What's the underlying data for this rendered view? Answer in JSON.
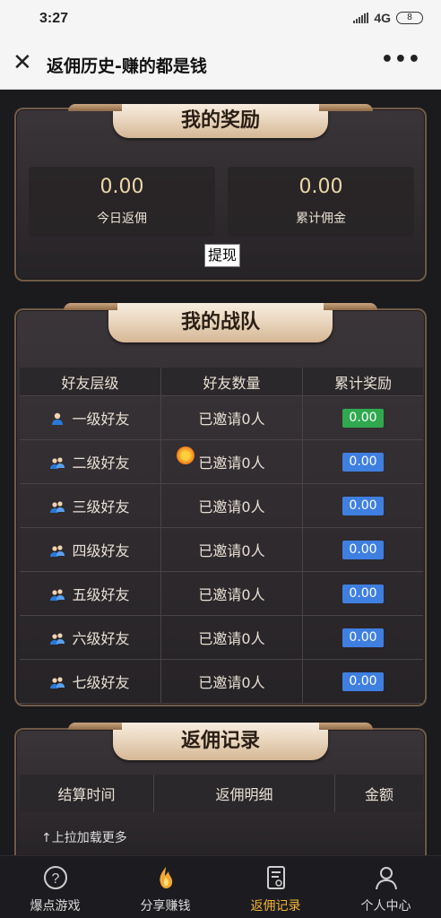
{
  "status_bar": {
    "time": "3:27",
    "network": "4G",
    "battery": "8"
  },
  "title_bar": {
    "title": "返佣历史-赚的都是钱",
    "close_icon": "close-icon",
    "more_icon": "more-icon"
  },
  "rewards": {
    "title": "我的奖励",
    "today": {
      "value": "0.00",
      "label": "今日返佣"
    },
    "total": {
      "value": "0.00",
      "label": "累计佣金"
    },
    "withdraw_label": "提现"
  },
  "team": {
    "title": "我的战队",
    "headers": [
      "好友层级",
      "好友数量",
      "累计奖励"
    ],
    "rows": [
      {
        "level": "一级好友",
        "count": "已邀请0人",
        "reward": "0.00",
        "badge_color": "#2fa84f"
      },
      {
        "level": "二级好友",
        "count": "已邀请0人",
        "reward": "0.00",
        "badge_color": "#3f7fe0"
      },
      {
        "level": "三级好友",
        "count": "已邀请0人",
        "reward": "0.00",
        "badge_color": "#3f7fe0"
      },
      {
        "level": "四级好友",
        "count": "已邀请0人",
        "reward": "0.00",
        "badge_color": "#3f7fe0"
      },
      {
        "level": "五级好友",
        "count": "已邀请0人",
        "reward": "0.00",
        "badge_color": "#3f7fe0"
      },
      {
        "level": "六级好友",
        "count": "已邀请0人",
        "reward": "0.00",
        "badge_color": "#3f7fe0"
      },
      {
        "level": "七级好友",
        "count": "已邀请0人",
        "reward": "0.00",
        "badge_color": "#3f7fe0"
      }
    ]
  },
  "records": {
    "title": "返佣记录",
    "headers": [
      "结算时间",
      "返佣明细",
      "金额"
    ],
    "load_more": "↑上拉加载更多"
  },
  "bottom_nav": [
    {
      "label": "爆点游戏",
      "icon": "help-circle-icon",
      "active": false
    },
    {
      "label": "分享赚钱",
      "icon": "flame-icon",
      "active": false
    },
    {
      "label": "返佣记录",
      "icon": "record-icon",
      "active": true
    },
    {
      "label": "个人中心",
      "icon": "user-icon",
      "active": false
    }
  ],
  "colors": {
    "accent_active": "#f2b335",
    "gold_value": "#ecd9a8",
    "badge_green": "#2fa84f",
    "badge_blue": "#3f7fe0"
  }
}
